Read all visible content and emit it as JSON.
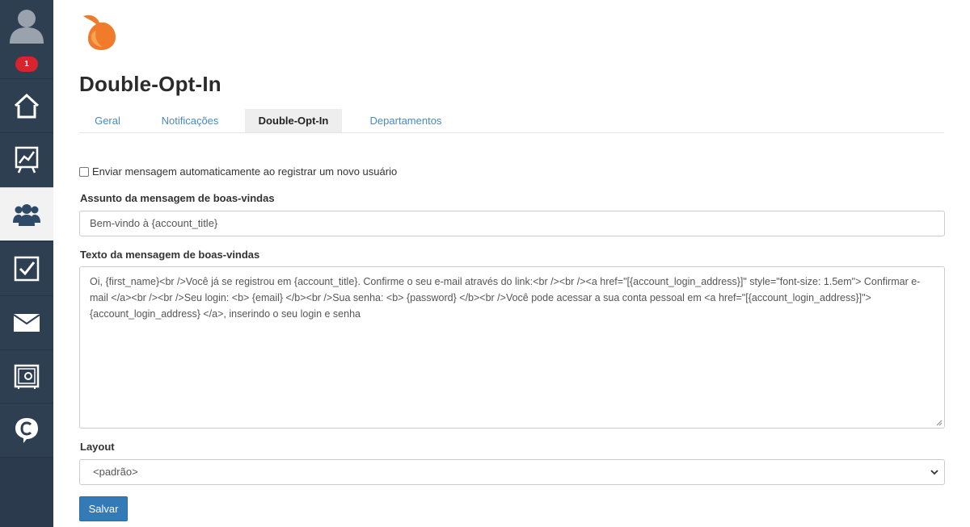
{
  "sidebar": {
    "notification_count": "1",
    "items": [
      {
        "name": "home-icon"
      },
      {
        "name": "chart-board-icon"
      },
      {
        "name": "users-icon"
      },
      {
        "name": "checkbox-icon"
      },
      {
        "name": "mail-icon"
      },
      {
        "name": "safe-icon"
      },
      {
        "name": "chat-c-icon"
      }
    ],
    "active_index": 2
  },
  "header": {
    "title": "Double-Opt-In"
  },
  "tabs": [
    {
      "label": "Geral",
      "active": false
    },
    {
      "label": "Notificações",
      "active": false
    },
    {
      "label": "Double-Opt-In",
      "active": true
    },
    {
      "label": "Departamentos",
      "active": false
    }
  ],
  "form": {
    "auto_send_label": "Enviar mensagem automaticamente ao registrar um novo usuário",
    "auto_send_checked": false,
    "subject_label": "Assunto da mensagem de boas-vindas",
    "subject_value": "Bem-vindo à {account_title}",
    "body_label": "Texto da mensagem de boas-vindas",
    "body_value": "Oi, {first_name}<br />Você já se registrou em {account_title}. Confirme o seu e-mail através do link:<br /><br /><a href=\"[{account_login_address}]\" style=\"font-size: 1.5em\"> Confirmar e-mail </a><br /><br />Seu login: <b> {email} </b><br />Sua senha: <b> {password} </b><br />Você pode acessar a sua conta pessoal em <a href=\"[{account_login_address}]\"> {account_login_address} </a>, inserindo o seu login e senha",
    "layout_label": "Layout",
    "layout_value": "<padrão>",
    "save_label": "Salvar"
  },
  "colors": {
    "sidebar_bg": "#2f3f52",
    "accent": "#337ab7",
    "link": "#4a88c3",
    "badge": "#d9232d",
    "logo": "#f07b2b"
  }
}
